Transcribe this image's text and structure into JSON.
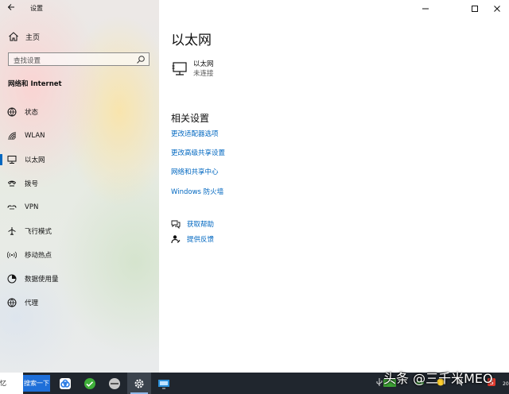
{
  "window": {
    "title": "设置"
  },
  "sidebar": {
    "home_label": "主页",
    "search_placeholder": "查找设置",
    "section_title": "网络和 Internet",
    "items": [
      {
        "label": "状态",
        "icon": "globe-icon"
      },
      {
        "label": "WLAN",
        "icon": "wifi-icon"
      },
      {
        "label": "以太网",
        "icon": "ethernet-icon",
        "selected": true
      },
      {
        "label": "拨号",
        "icon": "phone-icon"
      },
      {
        "label": "VPN",
        "icon": "vpn-icon"
      },
      {
        "label": "飞行模式",
        "icon": "airplane-icon"
      },
      {
        "label": "移动热点",
        "icon": "hotspot-icon"
      },
      {
        "label": "数据使用量",
        "icon": "data-usage-icon"
      },
      {
        "label": "代理",
        "icon": "proxy-globe-icon"
      }
    ]
  },
  "main": {
    "title": "以太网",
    "ethernet": {
      "name": "以太网",
      "status": "未连接"
    },
    "related_title": "相关设置",
    "links": [
      "更改适配器选项",
      "更改高级共享设置",
      "网络和共享中心",
      "Windows 防火墙"
    ],
    "help": [
      {
        "label": "获取帮助",
        "icon": "chat-help-icon"
      },
      {
        "label": "提供反馈",
        "icon": "feedback-icon"
      }
    ]
  },
  "taskbar": {
    "search_text": "忆",
    "search_button": "搜索一下",
    "apps": [
      "baidu-netdisk-icon",
      "green-browser-icon",
      "media-icon",
      "settings-gear-icon",
      "remote-desktop-icon"
    ],
    "watermark": "头条 @三千米MEO",
    "clock_fragment": "20"
  },
  "colors": {
    "accent": "#0067c0",
    "taskbar": "#20262e"
  }
}
